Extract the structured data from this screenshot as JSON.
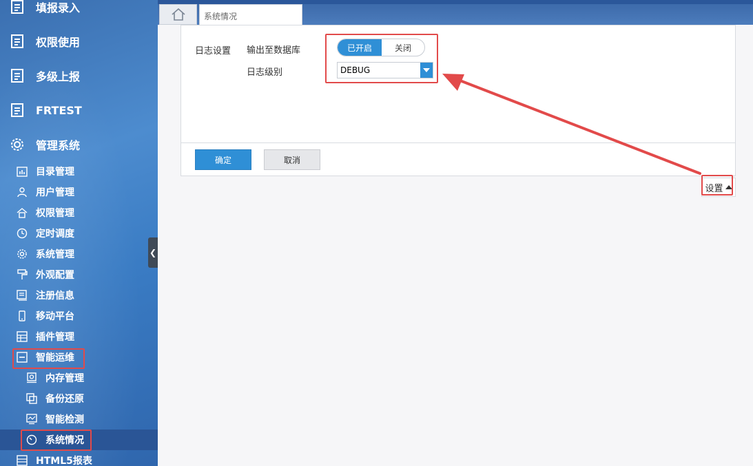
{
  "sidebar": {
    "top_items": [
      {
        "label": "填报录入",
        "icon": "report-icon"
      },
      {
        "label": "权限使用",
        "icon": "report-icon"
      },
      {
        "label": "多级上报",
        "icon": "report-icon"
      },
      {
        "label": "FRTEST",
        "icon": "report-icon"
      },
      {
        "label": "管理系统",
        "icon": "gear-icon"
      }
    ],
    "sub_items": [
      {
        "label": "目录管理",
        "icon": "chart-icon"
      },
      {
        "label": "用户管理",
        "icon": "user-icon"
      },
      {
        "label": "权限管理",
        "icon": "lock-icon"
      },
      {
        "label": "定时调度",
        "icon": "clock-icon"
      },
      {
        "label": "系统管理",
        "icon": "gear-icon"
      },
      {
        "label": "外观配置",
        "icon": "paint-roller-icon"
      },
      {
        "label": "注册信息",
        "icon": "document-icon"
      },
      {
        "label": "移动平台",
        "icon": "mobile-icon"
      },
      {
        "label": "插件管理",
        "icon": "grid-icon"
      },
      {
        "label": "智能运维",
        "icon": "minus-square-icon"
      }
    ],
    "ops_items": [
      {
        "label": "内存管理",
        "icon": "memory-icon"
      },
      {
        "label": "备份还原",
        "icon": "backup-icon"
      },
      {
        "label": "智能检测",
        "icon": "monitor-icon"
      },
      {
        "label": "系统情况",
        "icon": "gauge-icon"
      }
    ],
    "bottom_item": {
      "label": "HTML5报表",
      "icon": "grid-icon"
    }
  },
  "tabs": {
    "home_icon": "home-icon",
    "active_tab": "系统情况"
  },
  "form": {
    "log_settings_label": "日志设置",
    "output_db_label": "输出至数据库",
    "toggle_on": "已开启",
    "toggle_off": "关闭",
    "log_level_label": "日志级别",
    "log_level_value": "DEBUG",
    "confirm": "确定",
    "cancel": "取消"
  },
  "settings_toggle": {
    "label": "设置"
  },
  "colors": {
    "accent": "#2f8fd6",
    "annotation": "#e24a4a",
    "sidebar_active": "#2a5596"
  }
}
